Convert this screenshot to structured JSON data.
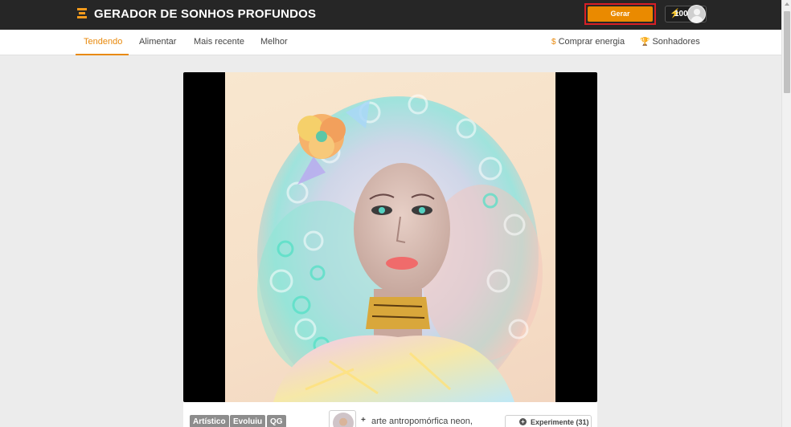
{
  "header": {
    "brand": "GERADOR DE SONHOS PROFUNDOS",
    "generate_label": "Gerar",
    "energy_count": "100",
    "accent_color": "#ea8a00",
    "highlight_color": "#d81f26",
    "icons": [
      "logo-icon",
      "lightning-icon",
      "user-avatar-icon"
    ]
  },
  "nav": {
    "tabs": [
      {
        "label": "Tendendo",
        "active": true
      },
      {
        "label": "Alimentar",
        "active": false
      },
      {
        "label": "Mais recente",
        "active": false
      },
      {
        "label": "Melhor",
        "active": false
      }
    ],
    "right": {
      "buy_energy": {
        "icon": "dollar-icon",
        "label": "Comprar energia"
      },
      "dreamers": {
        "icon": "trophy-icon",
        "label": "Sonhadores"
      }
    }
  },
  "post": {
    "image_alt": "Curly-haired neon portrait artwork",
    "tags": [
      "Artístico",
      "Evoluiu",
      "QG"
    ],
    "prompt": "arte antropomórfica neon,",
    "experiment_label": "Experimente (31)"
  }
}
